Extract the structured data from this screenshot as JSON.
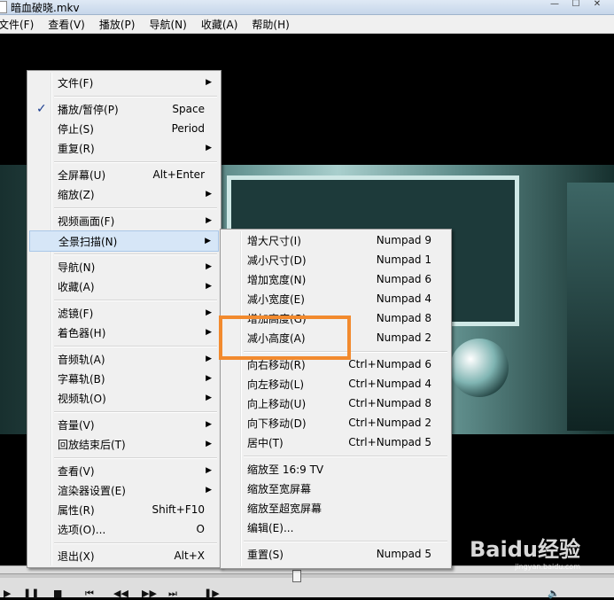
{
  "window": {
    "title": "暗血破晓.mkv"
  },
  "menubar": [
    "文件(F)",
    "查看(V)",
    "播放(P)",
    "导航(N)",
    "收藏(A)",
    "帮助(H)"
  ],
  "menu": {
    "items": [
      {
        "label": "文件(F)",
        "shortcut": "",
        "arrow": true,
        "checked": false
      },
      {
        "label": "播放/暂停(P)",
        "shortcut": "Space",
        "arrow": false,
        "checked": true
      },
      {
        "label": "停止(S)",
        "shortcut": "Period",
        "arrow": false,
        "checked": false
      },
      {
        "label": "重复(R)",
        "shortcut": "",
        "arrow": true,
        "checked": false
      },
      {
        "label": "全屏幕(U)",
        "shortcut": "Alt+Enter",
        "arrow": false,
        "checked": false
      },
      {
        "label": "缩放(Z)",
        "shortcut": "",
        "arrow": true,
        "checked": false
      },
      {
        "label": "视频画面(F)",
        "shortcut": "",
        "arrow": true,
        "checked": false
      },
      {
        "label": "全景扫描(N)",
        "shortcut": "",
        "arrow": true,
        "checked": false
      },
      {
        "label": "导航(N)",
        "shortcut": "",
        "arrow": true,
        "checked": false
      },
      {
        "label": "收藏(A)",
        "shortcut": "",
        "arrow": true,
        "checked": false
      },
      {
        "label": "滤镜(F)",
        "shortcut": "",
        "arrow": true,
        "checked": false
      },
      {
        "label": "着色器(H)",
        "shortcut": "",
        "arrow": true,
        "checked": false
      },
      {
        "label": "音频轨(A)",
        "shortcut": "",
        "arrow": true,
        "checked": false
      },
      {
        "label": "字幕轨(B)",
        "shortcut": "",
        "arrow": true,
        "checked": false
      },
      {
        "label": "视频轨(O)",
        "shortcut": "",
        "arrow": true,
        "checked": false
      },
      {
        "label": "音量(V)",
        "shortcut": "",
        "arrow": true,
        "checked": false
      },
      {
        "label": "回放结束后(T)",
        "shortcut": "",
        "arrow": true,
        "checked": false
      },
      {
        "label": "查看(V)",
        "shortcut": "",
        "arrow": true,
        "checked": false
      },
      {
        "label": "渲染器设置(E)",
        "shortcut": "",
        "arrow": true,
        "checked": false
      },
      {
        "label": "属性(R)",
        "shortcut": "Shift+F10",
        "arrow": false,
        "checked": false
      },
      {
        "label": "选项(O)...",
        "shortcut": "O",
        "arrow": false,
        "checked": false
      },
      {
        "label": "退出(X)",
        "shortcut": "Alt+X",
        "arrow": false,
        "checked": false
      }
    ],
    "hover_label": "全景扫描(N)"
  },
  "submenu": {
    "items": [
      {
        "label": "增大尺寸(I)",
        "shortcut": "Numpad 9"
      },
      {
        "label": "减小尺寸(D)",
        "shortcut": "Numpad 1"
      },
      {
        "label": "增加宽度(N)",
        "shortcut": "Numpad 6"
      },
      {
        "label": "减小宽度(E)",
        "shortcut": "Numpad 4"
      },
      {
        "label": "增加高度(G)",
        "shortcut": "Numpad 8"
      },
      {
        "label": "减小高度(A)",
        "shortcut": "Numpad 2"
      },
      {
        "label": "向右移动(R)",
        "shortcut": "Ctrl+Numpad 6"
      },
      {
        "label": "向左移动(L)",
        "shortcut": "Ctrl+Numpad 4"
      },
      {
        "label": "向上移动(U)",
        "shortcut": "Ctrl+Numpad 8"
      },
      {
        "label": "向下移动(D)",
        "shortcut": "Ctrl+Numpad 2"
      },
      {
        "label": "居中(T)",
        "shortcut": "Ctrl+Numpad 5"
      },
      {
        "label": "缩放至 16:9 TV",
        "shortcut": ""
      },
      {
        "label": "缩放至宽屏幕",
        "shortcut": ""
      },
      {
        "label": "缩放至超宽屏幕",
        "shortcut": ""
      },
      {
        "label": "编辑(E)...",
        "shortcut": ""
      },
      {
        "label": "重置(S)",
        "shortcut": "Numpad 5"
      }
    ],
    "highlighted_label": "减小高度(A)"
  },
  "colors": {
    "highlight_border": "#f28a2e",
    "menu_bg": "#f0f0f0",
    "hover_bg": "#d6e6f7"
  },
  "watermark": {
    "text": "Baidu经验",
    "sub": "jingyan.baidu.com"
  }
}
